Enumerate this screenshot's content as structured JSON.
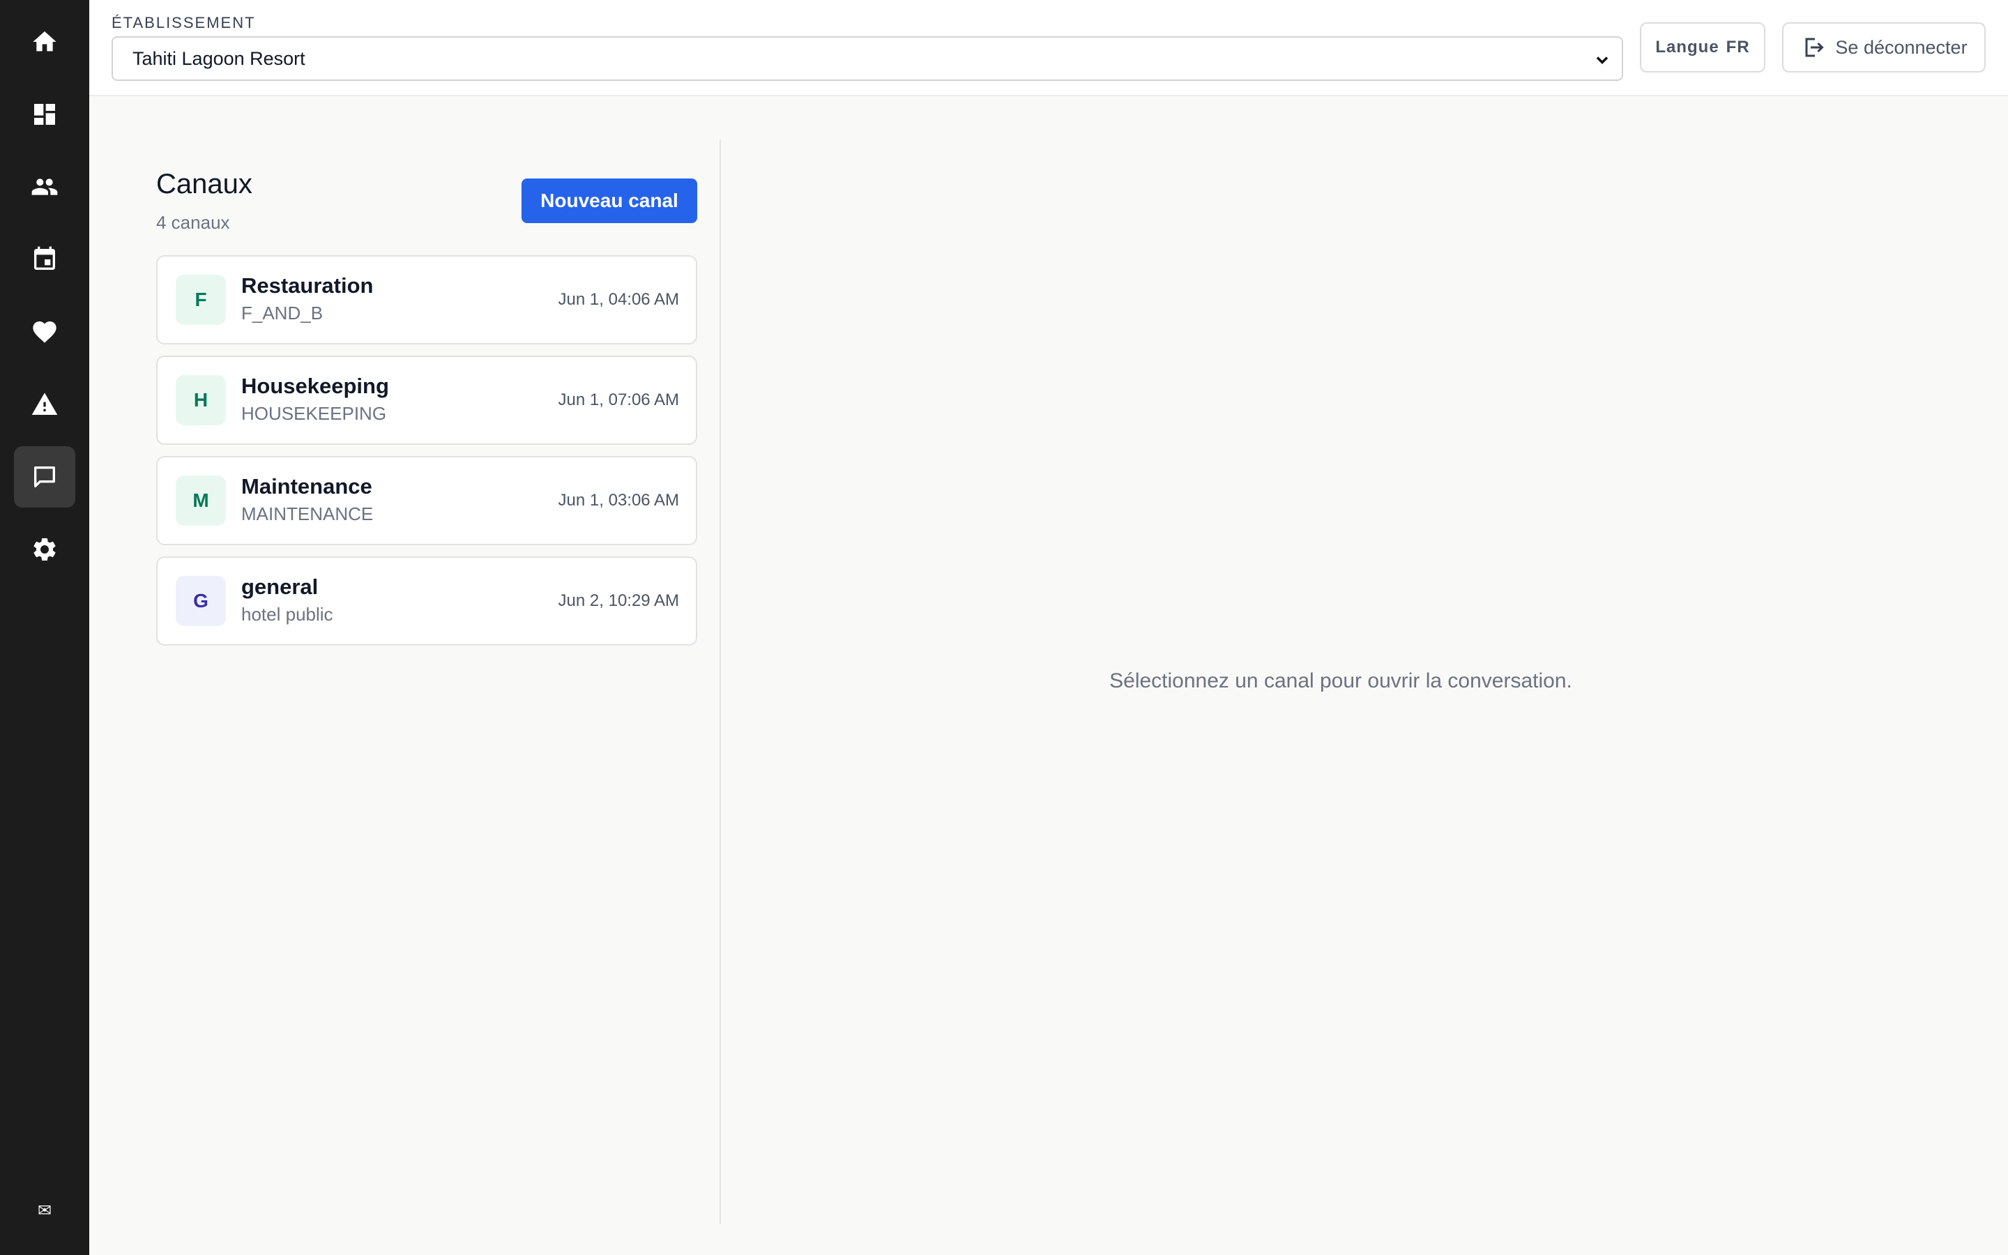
{
  "sidebar": {
    "items": [
      {
        "icon": "home-icon"
      },
      {
        "icon": "dashboard-icon"
      },
      {
        "icon": "people-icon"
      },
      {
        "icon": "calendar-icon"
      },
      {
        "icon": "heart-icon"
      },
      {
        "icon": "warning-icon"
      },
      {
        "icon": "chat-icon",
        "active": true
      },
      {
        "icon": "gear-icon"
      }
    ],
    "footer_glyph": "✉"
  },
  "topbar": {
    "establishment_label": "ÉTABLISSEMENT",
    "establishment_value": "Tahiti Lagoon Resort",
    "language_label": "Langue",
    "language_value": "FR",
    "logout_label": "Se déconnecter"
  },
  "channels": {
    "title": "Canaux",
    "count": "4 canaux",
    "new_button": "Nouveau canal",
    "items": [
      {
        "initial": "F",
        "name": "Restauration",
        "code": "F_AND_B",
        "time": "Jun 1, 04:06 AM",
        "avatar_bg": "#e8f8f1",
        "avatar_fg": "#047857"
      },
      {
        "initial": "H",
        "name": "Housekeeping",
        "code": "HOUSEKEEPING",
        "time": "Jun 1, 07:06 AM",
        "avatar_bg": "#e8f8f1",
        "avatar_fg": "#047857"
      },
      {
        "initial": "M",
        "name": "Maintenance",
        "code": "MAINTENANCE",
        "time": "Jun 1, 03:06 AM",
        "avatar_bg": "#e8f8f1",
        "avatar_fg": "#047857"
      },
      {
        "initial": "G",
        "name": "general",
        "code": "hotel public",
        "time": "Jun 2, 10:29 AM",
        "avatar_bg": "#eef0fc",
        "avatar_fg": "#3730a3"
      }
    ]
  },
  "conversation": {
    "empty_message": "Sélectionnez un canal pour ouvrir la conversation."
  },
  "colors": {
    "sidebar_bg": "#1c1c1c",
    "primary": "#2563eb",
    "page_bg": "#f9f9f8"
  }
}
